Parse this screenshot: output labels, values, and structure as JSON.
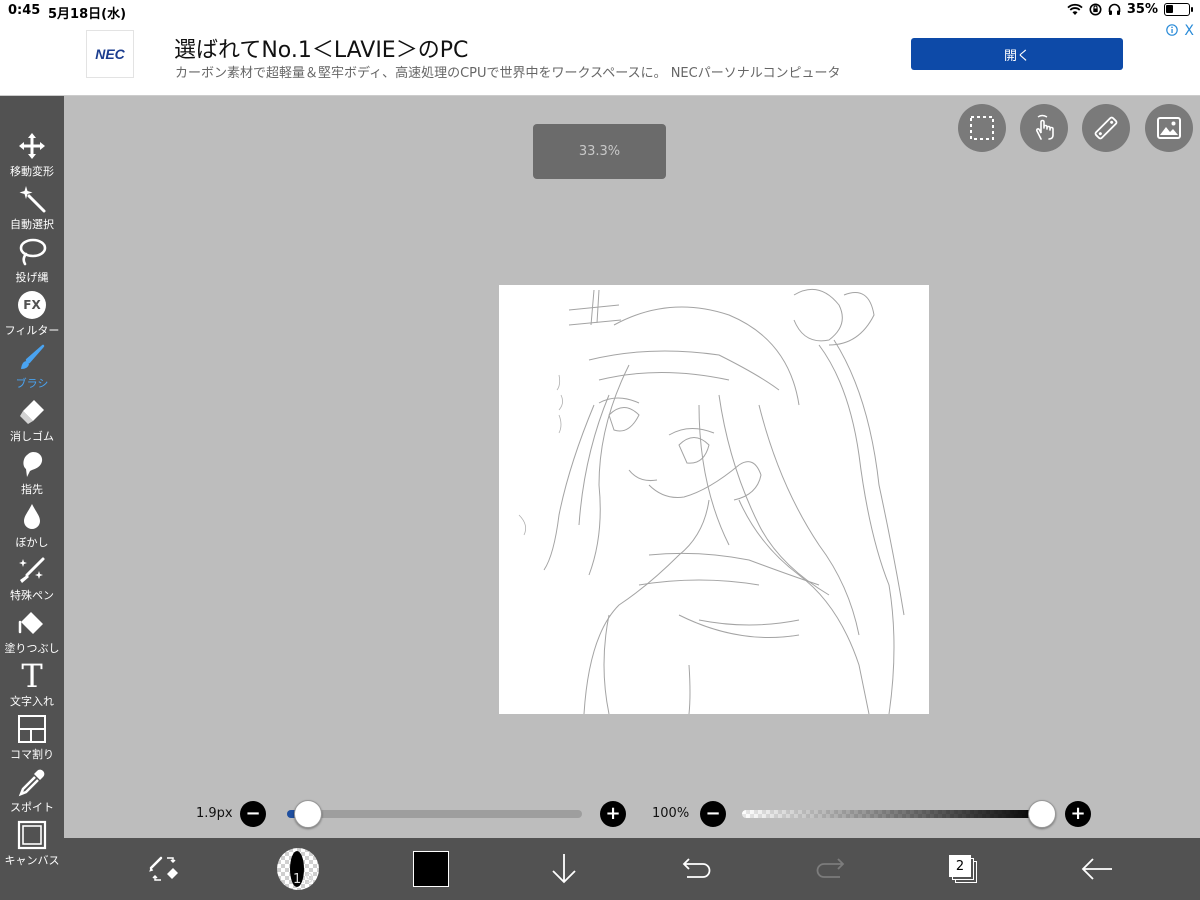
{
  "status": {
    "time": "0:45",
    "date": "5月18日(水)",
    "battery": "35%",
    "battery_level": 0.35
  },
  "ad": {
    "logo": "NEC",
    "title": "選ばれてNo.1＜LAVIE＞のPC",
    "subtitle": "カーボン素材で超軽量＆堅牢ボディ、高速処理のCPUで世界中をワークスペースに。 NECパーソナルコンピュータ",
    "open_label": "開く",
    "close_label": "X"
  },
  "tools": [
    {
      "label": "移動変形",
      "icon": "move-icon"
    },
    {
      "label": "自動選択",
      "icon": "magic-wand-icon"
    },
    {
      "label": "投げ縄",
      "icon": "lasso-icon"
    },
    {
      "label": "フィルター",
      "icon": "fx-icon",
      "glyph": "FX"
    },
    {
      "label": "ブラシ",
      "icon": "brush-icon",
      "active": true
    },
    {
      "label": "消しゴム",
      "icon": "eraser-icon"
    },
    {
      "label": "指先",
      "icon": "finger-icon"
    },
    {
      "label": "ぼかし",
      "icon": "blur-icon"
    },
    {
      "label": "特殊ペン",
      "icon": "special-pen-icon"
    },
    {
      "label": "塗りつぶし",
      "icon": "fill-icon"
    },
    {
      "label": "文字入れ",
      "icon": "text-icon",
      "glyph": "T"
    },
    {
      "label": "コマ割り",
      "icon": "frame-divider-icon"
    },
    {
      "label": "スポイト",
      "icon": "eyedropper-icon"
    },
    {
      "label": "キャンバス",
      "icon": "canvas-icon"
    }
  ],
  "zoom": {
    "value": "33.3%"
  },
  "top_tools": [
    "selection-icon",
    "touch-icon",
    "ruler-icon",
    "material-icon"
  ],
  "brush_size": {
    "label": "1.9px",
    "value_fraction": 0.04
  },
  "opacity": {
    "label": "100%",
    "value_fraction": 1.0
  },
  "bottom": {
    "brush_size_badge": "1.9",
    "color": "#000000",
    "layer_count": "2"
  },
  "colors": {
    "toolbar": "#525252",
    "workspace": "#bdbdbd",
    "accent": "#4aa3f0",
    "ad_button": "#0d4aa8"
  }
}
